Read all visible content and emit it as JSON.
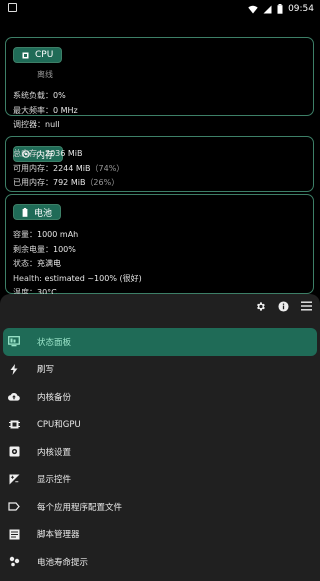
{
  "status_bar": {
    "time": "09:54"
  },
  "cpu": {
    "title": "CPU",
    "state": "离线",
    "rows": [
      {
        "label": "系统负载：",
        "value": "0%"
      },
      {
        "label": "最大频率：",
        "value": "0 MHz"
      },
      {
        "label": "调控器：",
        "value": "null"
      }
    ]
  },
  "memory": {
    "title": "内存",
    "rows": [
      {
        "label": "总内存：",
        "value": "3036 MiB",
        "extra": ""
      },
      {
        "label": "可用内存：",
        "value": "2244 MiB",
        "extra": "（74%）"
      },
      {
        "label": "已用内存：",
        "value": "792 MiB",
        "extra": "（26%）"
      }
    ]
  },
  "battery": {
    "title": "电池",
    "rows": [
      {
        "label": "容量：",
        "value": "1000 mAh"
      },
      {
        "label": "剩余电量：",
        "value": "100%"
      },
      {
        "label": "状态：",
        "value": "充满电"
      },
      {
        "label": "Health: ",
        "value": "estimated ~100% (很好)"
      },
      {
        "label": "温度：",
        "value": "30°C"
      }
    ]
  },
  "drawer": {
    "items": [
      {
        "label": "状态面板",
        "icon": "dashboard-icon",
        "active": true
      },
      {
        "label": "刷写",
        "icon": "flash-icon"
      },
      {
        "label": "内核备份",
        "icon": "cloud-upload-icon"
      },
      {
        "label": "CPU和GPU",
        "icon": "chip-icon"
      },
      {
        "label": "内核设置",
        "icon": "settings-square-icon"
      },
      {
        "label": "显示控件",
        "icon": "display-icon"
      },
      {
        "label": "每个应用程序配置文件",
        "icon": "label-icon"
      },
      {
        "label": "脚本管理器",
        "icon": "script-icon"
      },
      {
        "label": "电池寿命提示",
        "icon": "battery-tips-icon"
      }
    ]
  },
  "colors": {
    "accent": "#1f6b57",
    "accent_border": "#3d7f67",
    "drawer_bg": "#202020",
    "active_text": "#9be4c9"
  }
}
